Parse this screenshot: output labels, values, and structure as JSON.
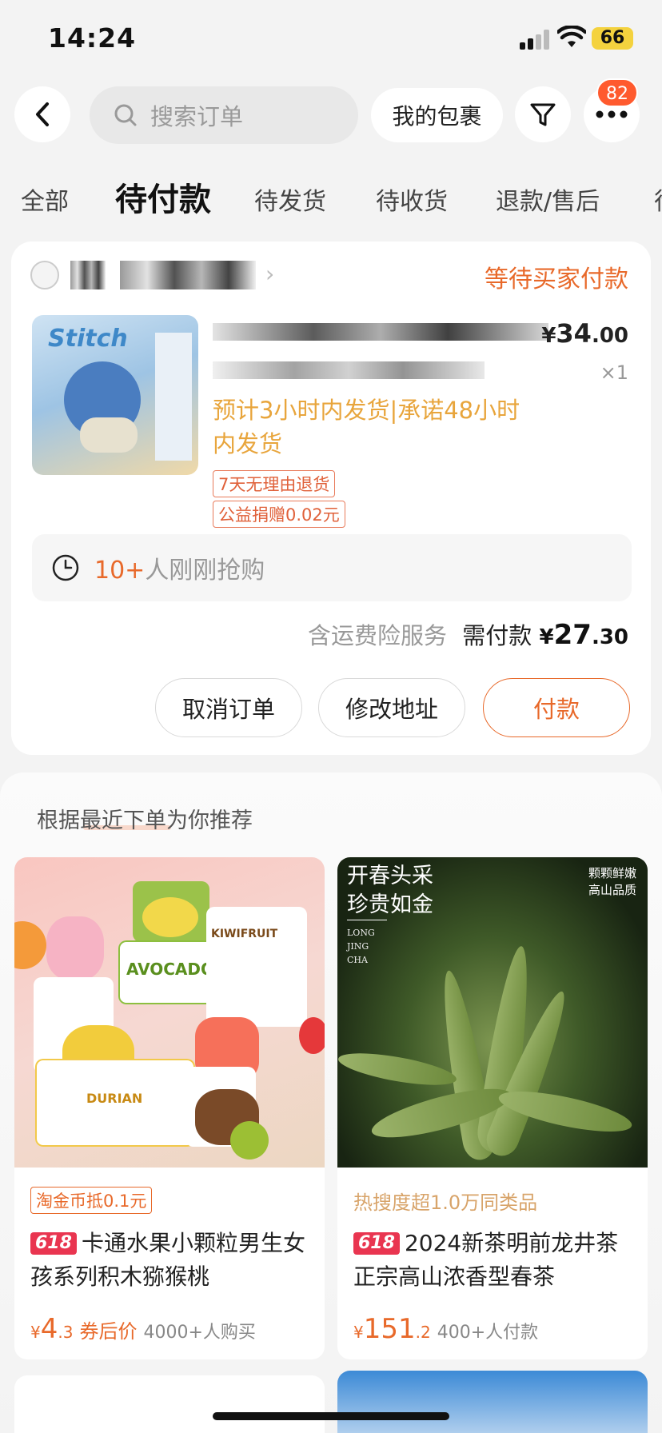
{
  "status_bar": {
    "time": "14:24",
    "battery": "66"
  },
  "header": {
    "search_placeholder": "搜索订单",
    "my_packages": "我的包裹",
    "badge_count": "82"
  },
  "tabs": [
    {
      "label": "全部"
    },
    {
      "label": "待付款"
    },
    {
      "label": "待发货"
    },
    {
      "label": "待收货"
    },
    {
      "label": "退款/售后"
    },
    {
      "label": "待"
    }
  ],
  "order": {
    "status": "等待买家付款",
    "image_text": "Stitch",
    "price_symbol": "¥",
    "price_int": "34",
    "price_dec": ".00",
    "quantity": "×1",
    "shipping_note": "预计3小时内发货|承诺48小时内发货",
    "tag_return": "7天无理由退货",
    "tag_charity": "公益捐赠0.02元",
    "rush_count": "10+",
    "rush_text": "人刚刚抢购",
    "insurance": "含运费险服务",
    "need_pay_label": "需付款",
    "pay_symbol": "¥",
    "pay_int": "27",
    "pay_dec": ".30",
    "buttons": {
      "cancel": "取消订单",
      "address": "修改地址",
      "pay": "付款"
    }
  },
  "recommend": {
    "title": "根据最近下单为你推荐",
    "items": [
      {
        "badge": "淘金币抵0.1元",
        "tag": "618",
        "name": "卡通水果小颗粒男生女孩系列积木猕猴桃",
        "symbol": "¥",
        "price_int": "4",
        "price_dec": ".3",
        "after_label": "券后价",
        "sold": "4000+人购买",
        "image_text": {
          "avocado": "AVOCADO",
          "kiwi": "KIWIFRUIT",
          "durian": "DURIAN"
        }
      },
      {
        "badge": "热搜度超1.0万同类品",
        "tag": "618",
        "name": "2024新茶明前龙井茶正宗高山浓香型春茶",
        "symbol": "¥",
        "price_int": "151",
        "price_dec": ".2",
        "sold": "400+人付款",
        "image_text": {
          "title_line1": "开春头采",
          "title_line2": "珍贵如金",
          "en1": "LONG",
          "en2": "JING",
          "en3": "CHA",
          "side1": "颗颗鲜嫩",
          "side2": "高山品质"
        }
      }
    ]
  }
}
